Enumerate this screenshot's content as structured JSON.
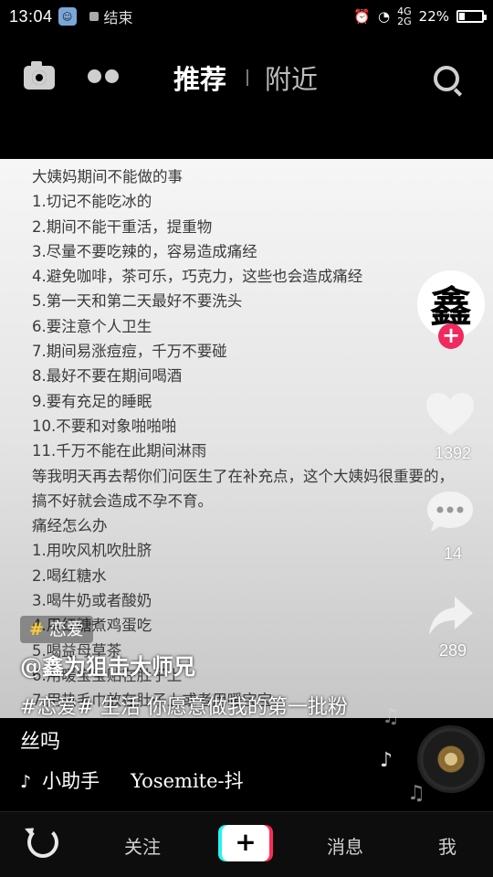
{
  "status_bar": {
    "time": "13:04",
    "notification_text": "结束",
    "network": "4G",
    "network2": "2G",
    "battery_percent": "22%",
    "battery_level": 0.22
  },
  "top_nav": {
    "tab_recommend": "推荐",
    "tab_nearby": "附近",
    "icons": [
      "camera-icon",
      "dots-icon",
      "search-icon"
    ]
  },
  "video_note": {
    "lines": [
      "大姨妈期间不能做的事",
      "1.切记不能吃冰的",
      "2.期间不能干重活，提重物",
      "3.尽量不要吃辣的，容易造成痛经",
      "4.避免咖啡，茶可乐，巧克力，这些也会造成痛经",
      "5.第一天和第二天最好不要洗头",
      "6.要注意个人卫生",
      "7.期间易涨痘痘，千万不要碰",
      "8.最好不要在期间喝酒",
      "9.要有充足的睡眠",
      "10.不要和对象啪啪啪",
      "11.千万不能在此期间淋雨",
      "等我明天再去帮你们问医生了在补充点，这个大姨妈很重要的，搞不好就会造成不孕不育。",
      "痛经怎么办",
      "1.用吹风机吹肚脐",
      "2.喝红糖水",
      "3.喝牛奶或者酸奶",
      "4.用红糖煮鸡蛋吃",
      "5.喝益母草茶",
      "6.用暖宝宝贴在肚子上",
      "7.用热毛巾放在肚子上或者用暖宝宝"
    ]
  },
  "side_actions": {
    "avatar_glyph": "鑫",
    "follow_plus": "+",
    "likes": "1392",
    "comments": "14",
    "shares": "289"
  },
  "overlay": {
    "hashtag_symbol": "#",
    "hashtag": "恋爱",
    "author": "@鑫为狙击大师兄",
    "caption": "#恋爱# 生活 你愿意做我的第一批粉丝吗",
    "music_icon": "♪",
    "music_song": "小助手",
    "music_artist": "Yosemite-抖"
  },
  "tab_bar": {
    "follow": "关注",
    "plus": "+",
    "messages": "消息",
    "me": "我"
  },
  "colors": {
    "accent_red": "#f0295f",
    "hashtag_yellow": "#ffcc33",
    "plus_cyan": "#25f4ee",
    "plus_red": "#fe2c55"
  }
}
